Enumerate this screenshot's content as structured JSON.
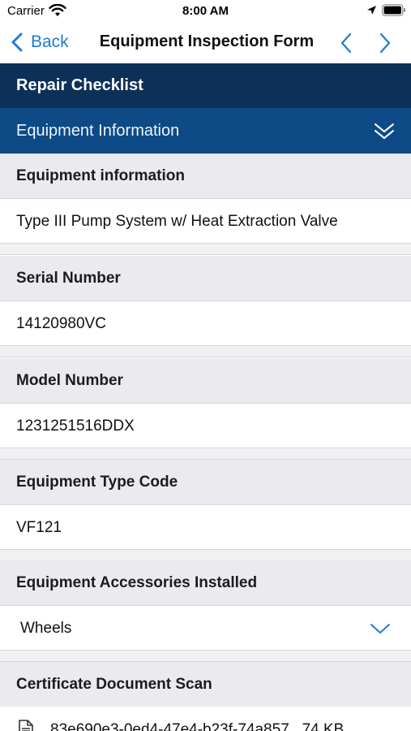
{
  "status_bar": {
    "carrier": "Carrier",
    "time": "8:00 AM"
  },
  "nav": {
    "back_label": "Back",
    "title": "Equipment Inspection Form"
  },
  "section": {
    "title": "Repair Checklist",
    "subsection_title": "Equipment Information"
  },
  "fields": [
    {
      "label": "Equipment information",
      "value": "Type III Pump System w/ Heat Extraction Valve"
    },
    {
      "label": "Serial Number",
      "value": "14120980VC"
    },
    {
      "label": "Model Number",
      "value": "1231251516DDX"
    },
    {
      "label": "Equipment Type Code",
      "value": "VF121"
    },
    {
      "label": "Equipment Accessories Installed",
      "value": "Wheels"
    }
  ],
  "certificate": {
    "label": "Certificate Document Scan",
    "file_text": "83e690e3-0ed4-47e4-b23f-74a857...74 KB"
  },
  "colors": {
    "accent": "#1f7bd1",
    "section_header": "#0d3058",
    "subsection_header": "#0d4a86",
    "field_label_bg": "#eaeaef"
  },
  "icons": {
    "wifi": "wifi-icon",
    "location": "location-arrow-icon",
    "battery": "battery-icon",
    "back": "chevron-left-icon",
    "prev": "chevron-left-icon",
    "next": "chevron-right-icon",
    "collapse": "double-chevron-down-icon",
    "select": "chevron-down-icon",
    "document": "document-icon"
  }
}
